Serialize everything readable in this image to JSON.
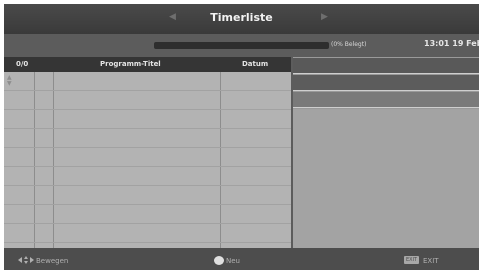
{
  "header": {
    "title": "Timerliste",
    "usage_text": "(0% Belegt)",
    "usage_percent": 0,
    "clock": "13:01 19 Feb"
  },
  "table": {
    "columns": [
      "0/0",
      "Programm-Titel",
      "Datum"
    ]
  },
  "footer": {
    "move_label": "Bewegen",
    "new_label": "Neu",
    "exit_key": "EXIT",
    "exit_label": "EXIT"
  }
}
